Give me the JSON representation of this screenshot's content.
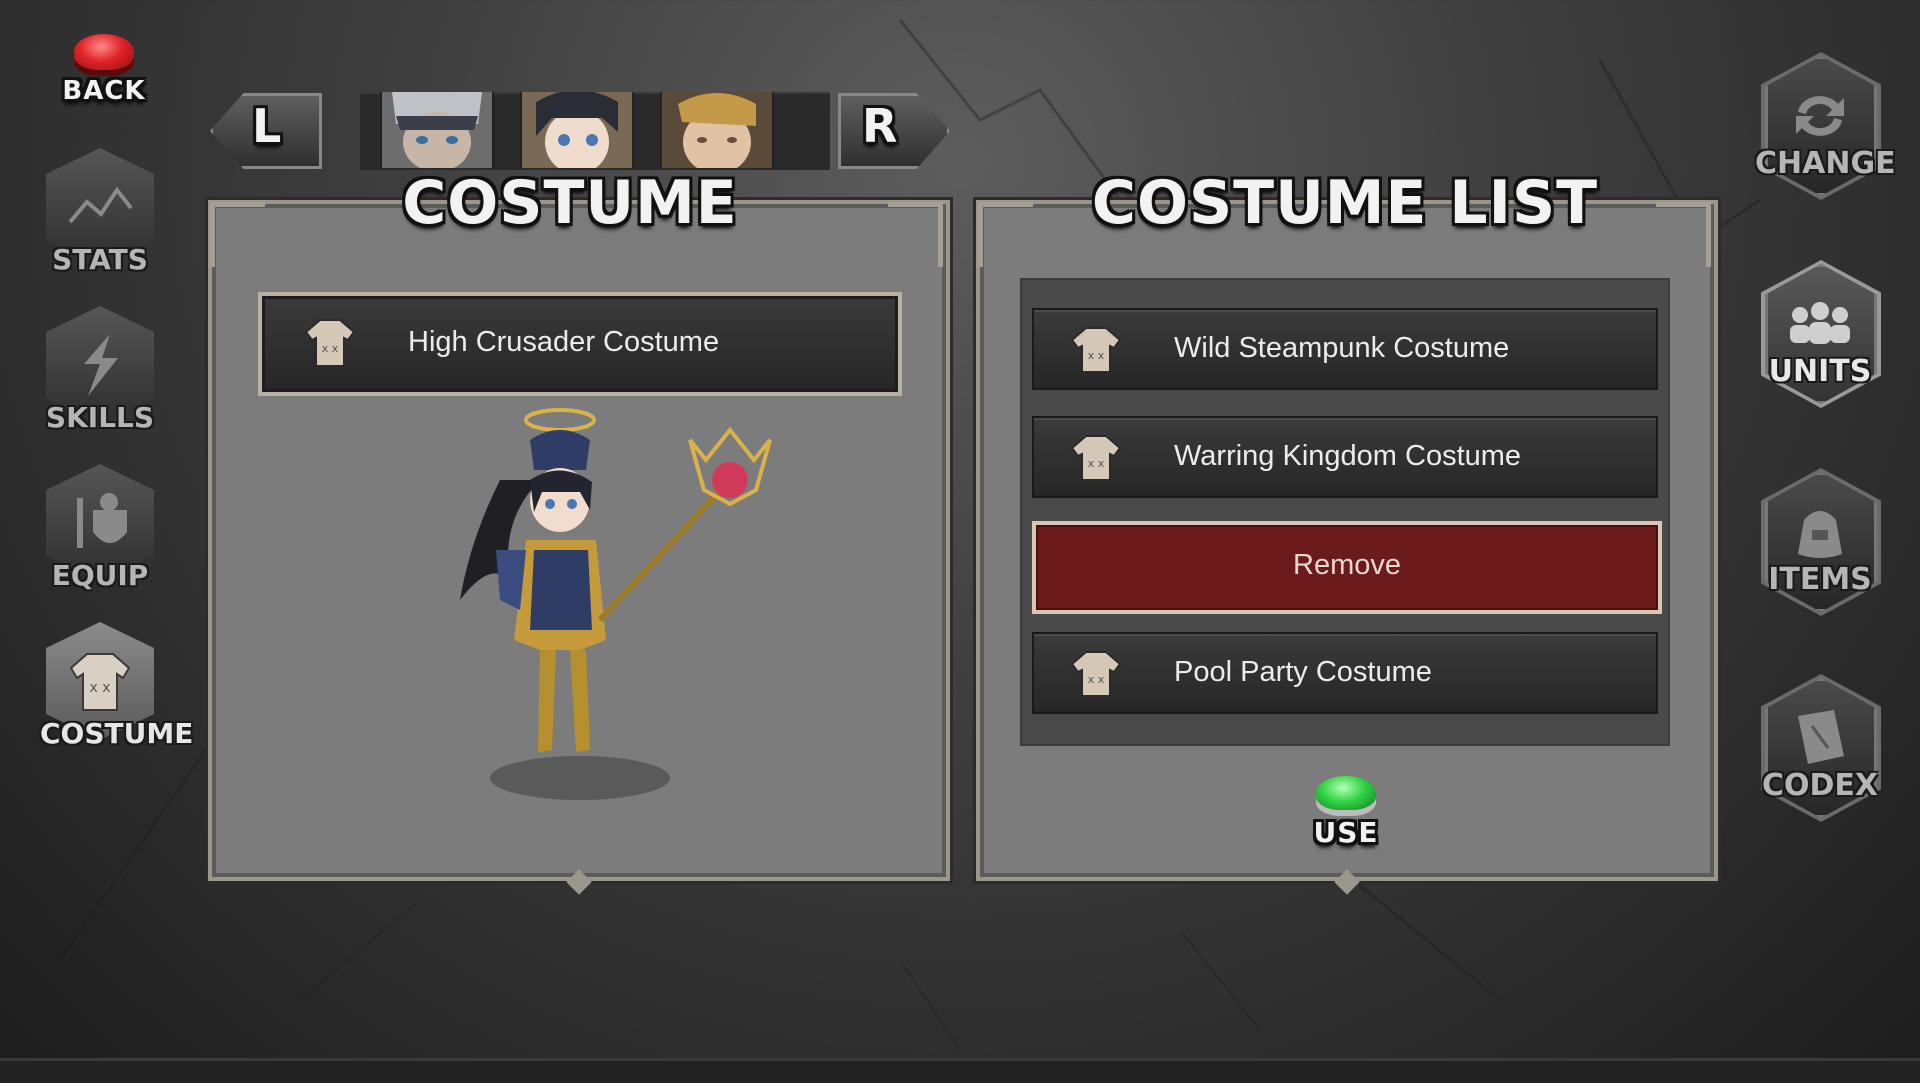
{
  "header": {
    "back_label": "BACK",
    "left_label": "L",
    "right_label": "R"
  },
  "left_nav": [
    {
      "label": "STATS",
      "icon": "stats-icon"
    },
    {
      "label": "SKILLS",
      "icon": "skills-icon"
    },
    {
      "label": "EQUIP",
      "icon": "equip-icon"
    },
    {
      "label": "COSTUME",
      "icon": "costume-icon",
      "active": true
    }
  ],
  "right_nav": [
    {
      "label": "CHANGE",
      "icon": "change-icon"
    },
    {
      "label": "UNITS",
      "icon": "units-icon"
    },
    {
      "label": "ITEMS",
      "icon": "bag-icon"
    },
    {
      "label": "CODEX",
      "icon": "book-icon"
    }
  ],
  "costume_panel": {
    "title": "COSTUME",
    "equipped": "High Crusader Costume"
  },
  "costume_list_panel": {
    "title": "COSTUME LIST",
    "items": [
      "Wild Steampunk Costume",
      "Warring Kingdom Costume"
    ],
    "remove_label": "Remove",
    "last_item": "Pool Party Costume",
    "use_label": "USE"
  },
  "colors": {
    "back_button": "#e0242a",
    "use_button": "#32d443",
    "remove_button": "#6b1b1b"
  }
}
